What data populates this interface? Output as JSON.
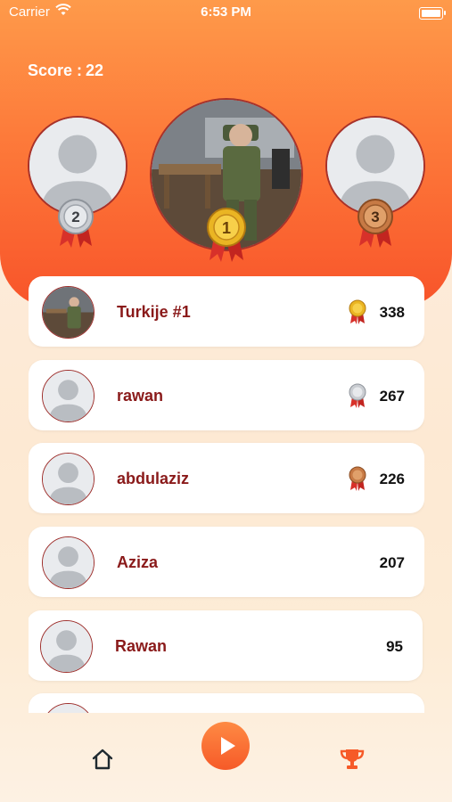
{
  "status": {
    "carrier": "Carrier",
    "time": "6:53 PM"
  },
  "header": {
    "score_label": "Score :",
    "score_value": "22"
  },
  "podium": {
    "first": {
      "rank": "1"
    },
    "second": {
      "rank": "2"
    },
    "third": {
      "rank": "3"
    }
  },
  "leaderboard": [
    {
      "name": "Turkije #1",
      "points": "338",
      "medal": "gold"
    },
    {
      "name": "rawan",
      "points": "267",
      "medal": "silver"
    },
    {
      "name": "abdulaziz",
      "points": "226",
      "medal": "bronze"
    },
    {
      "name": "Aziza",
      "points": "207",
      "medal": ""
    },
    {
      "name": "Rawan",
      "points": "95",
      "medal": ""
    }
  ],
  "colors": {
    "accent": "#f8542a",
    "name_text": "#8a1a1a",
    "gold": "#e8b21f",
    "silver": "#b8bcc2",
    "bronze": "#c77a45"
  },
  "icons": {
    "home": "home-icon",
    "play": "play-icon",
    "leaderboard": "trophy-icon"
  }
}
